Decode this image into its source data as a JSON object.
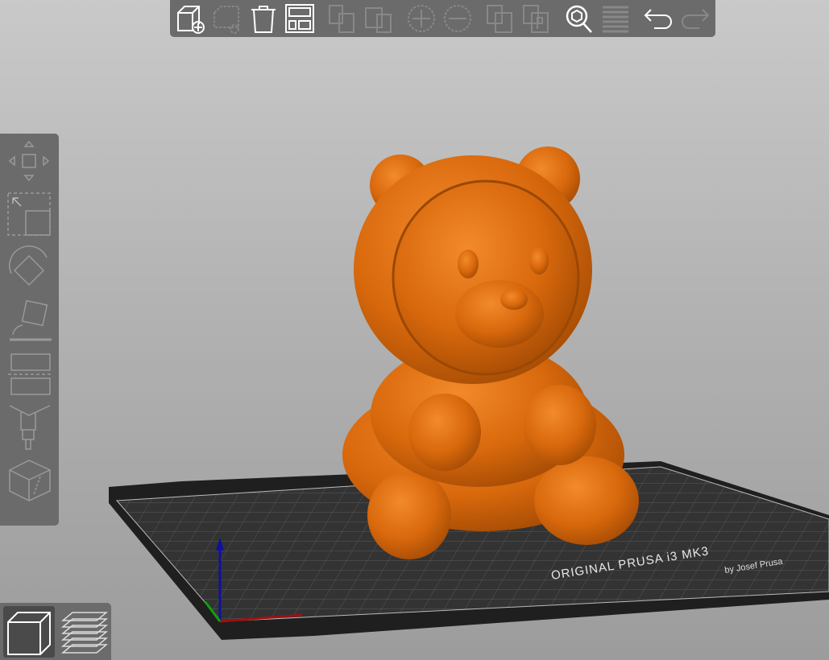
{
  "toolbar": {
    "buttons": [
      {
        "icon": "add-icon",
        "enabled": true
      },
      {
        "icon": "delete-icon",
        "enabled": false
      },
      {
        "icon": "delete-all-icon",
        "enabled": true
      },
      {
        "icon": "arrange-icon",
        "enabled": true
      },
      {
        "icon": "copy-icon",
        "enabled": false
      },
      {
        "icon": "paste-icon",
        "enabled": false
      },
      {
        "icon": "add-instance-icon",
        "enabled": false
      },
      {
        "icon": "remove-instance-icon",
        "enabled": false
      },
      {
        "icon": "split-objects-icon",
        "enabled": false
      },
      {
        "icon": "split-parts-icon",
        "enabled": false
      },
      {
        "icon": "search-icon",
        "enabled": true
      },
      {
        "icon": "layers-editing-icon",
        "enabled": false
      },
      {
        "icon": "undo-icon",
        "enabled": true
      },
      {
        "icon": "redo-icon",
        "enabled": false
      }
    ]
  },
  "gizmos": [
    "move-icon",
    "scale-icon",
    "rotate-icon",
    "place-on-face-icon",
    "cut-icon",
    "paint-supports-icon",
    "seam-icon"
  ],
  "views": [
    {
      "icon": "3d-view-icon",
      "active": true
    },
    {
      "icon": "preview-icon",
      "active": false
    }
  ],
  "bed": {
    "brand": "ORIGINAL PRUSA i3 MK3",
    "subtitle": "by Josef Prusa"
  },
  "colors": {
    "model": "#e8750f",
    "toolbar": "#6b6b6b",
    "bed": "#2e2e2e"
  }
}
